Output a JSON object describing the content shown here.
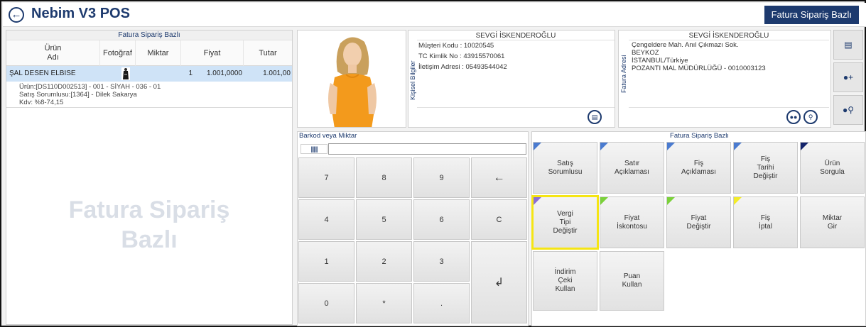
{
  "header": {
    "title": "Nebim V3 POS",
    "mode_badge": "Fatura Sipariş Bazlı"
  },
  "grid": {
    "title": "Fatura Sipariş Bazlı",
    "columns": {
      "urun_adi": "Ürün\nAdı",
      "fotograf": "Fotoğraf",
      "miktar": "Miktar",
      "fiyat": "Fiyat",
      "tutar": "Tutar"
    },
    "rows": [
      {
        "name": "ŞAL DESEN ELBISE",
        "miktar": "1",
        "fiyat": "1.001,0000",
        "tutar": "1.001,00",
        "detail_1": "Ürün:[DS110D002513] - 001 - SİYAH - 036 - 01",
        "detail_2": "Satış Sorumlusu:[1364] - Dilek Sakarya",
        "detail_3": "Kdv: %8-74,15"
      }
    ],
    "watermark": "Fatura Sipariş\nBazlı"
  },
  "customer": {
    "section_label": "Kişisel Bilgiler",
    "name": "SEVGİ İSKENDEROĞLU",
    "code_line": "Müşteri Kodu :  10020545",
    "tc_line": "TC Kimlik No  : 43915570061",
    "contact_line": "İletişim Adresi : 05493544042"
  },
  "address": {
    "section_label": "Fatura Adresi",
    "name": "SEVGİ İSKENDEROĞLU",
    "line_1": "Çengeldere Mah. Anıl Çıkmazı Sok.",
    "line_2": "BEYKOZ",
    "line_3": "İSTANBUL/Türkiye",
    "line_4": "POZANTI MAL MÜDÜRLÜĞÜ - 0010003123"
  },
  "numpad": {
    "title": "Barkod veya Miktar",
    "input_value": "",
    "keys": {
      "k7": "7",
      "k8": "8",
      "k9": "9",
      "back": "←",
      "k4": "4",
      "k5": "5",
      "k6": "6",
      "clear": "C",
      "k1": "1",
      "k2": "2",
      "k3": "3",
      "enter": "↲",
      "k0": "0",
      "star": "*",
      "dot": "."
    }
  },
  "functions": {
    "title": "Fatura Sipariş Bazlı",
    "buttons": {
      "satis_sorumlusu": "Satış\nSorumlusu",
      "satir_aciklamasi": "Satır\nAçıklaması",
      "fis_aciklamasi": "Fiş\nAçıklaması",
      "fis_tarihi_degistir": "Fiş\nTarihi\nDeğiştir",
      "urun_sorgula": "Ürün\nSorgula",
      "vergi_tipi_degistir": "Vergi\nTipi\nDeğiştir",
      "fiyat_iskontosu": "Fiyat\nİskontosu",
      "fiyat_degistir": "Fiyat\nDeğiştir",
      "fis_iptal": "Fiş\nİptal",
      "miktar_gir": "Miktar\nGir",
      "indirim_ceki_kullan": "İndirim\nÇeki\nKullan",
      "puan_kullan": "Puan\nKullan"
    },
    "corner_colors": {
      "blue": "#4a7bd0",
      "navy": "#14246b",
      "purple": "#8a6fd6",
      "green": "#7bd13a",
      "yellow": "#f3ec2a"
    },
    "highlight_color": "#f5e514"
  },
  "icons": {
    "back": "back-arrow-icon",
    "barcode": "barcode-icon",
    "contact_card": "contact-card-icon",
    "group": "group-icon",
    "location": "location-pin-icon",
    "person_add": "person-add-icon",
    "person_search": "person-search-icon"
  }
}
